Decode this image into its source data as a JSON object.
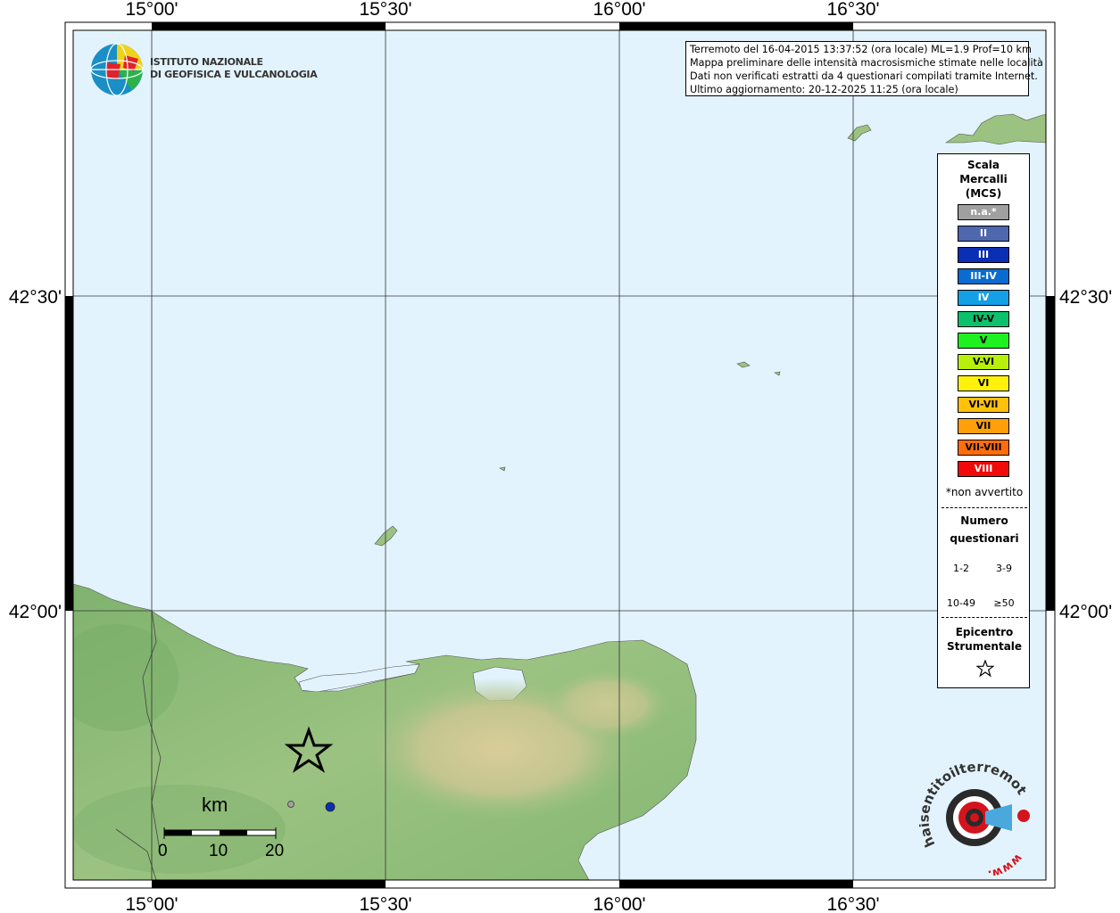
{
  "info": {
    "line1": "Terremoto del 16-04-2015 13:37:52 (ora locale) ML=1.9 Prof=10 km",
    "line2": "Mappa preliminare delle intensità macrosismiche stimate nelle località",
    "line3": "Dati non verificati estratti da 4 questionari compilati tramite Internet.",
    "line4": "Ultimo aggiornamento: 20-12-2025 11:25 (ora locale)"
  },
  "logo": {
    "line1": "ISTITUTO NAZIONALE",
    "line2": "DI GEOFISICA E VULCANOLOGIA"
  },
  "axes": {
    "lon_labels": [
      "15°00'",
      "15°30'",
      "16°00'",
      "16°30'"
    ],
    "lat_labels": [
      "42°30'",
      "42°00'"
    ]
  },
  "legend": {
    "title": [
      "Scala",
      "Mercalli",
      "(MCS)"
    ],
    "scale": [
      {
        "label": "n.a.*",
        "color": "#a0a0a0",
        "text": "#ffffff"
      },
      {
        "label": "II",
        "color": "#4f67ad",
        "text": "#ffffff"
      },
      {
        "label": "III",
        "color": "#0a2fb4",
        "text": "#ffffff"
      },
      {
        "label": "III-IV",
        "color": "#0a6ccf",
        "text": "#ffffff"
      },
      {
        "label": "IV",
        "color": "#14a0e6",
        "text": "#ffffff"
      },
      {
        "label": "IV-V",
        "color": "#0dc06b",
        "text": "#000000"
      },
      {
        "label": "V",
        "color": "#1ff01f",
        "text": "#000000"
      },
      {
        "label": "V-VI",
        "color": "#b8f00a",
        "text": "#000000"
      },
      {
        "label": "VI",
        "color": "#fff20a",
        "text": "#000000"
      },
      {
        "label": "VI-VII",
        "color": "#ffc10a",
        "text": "#000000"
      },
      {
        "label": "VII",
        "color": "#ffa00a",
        "text": "#000000"
      },
      {
        "label": "VII-VIII",
        "color": "#ff6e0a",
        "text": "#000000"
      },
      {
        "label": "VIII",
        "color": "#f00a0a",
        "text": "#ffffff"
      }
    ],
    "na_note": "*non avvertito",
    "count_title": [
      "Numero",
      "questionari"
    ],
    "counts": [
      "1-2",
      "3-9",
      "10-49",
      "≥50"
    ],
    "epicenter_title": [
      "Epicentro",
      "Strumentale"
    ]
  },
  "scalebar": {
    "unit": "km",
    "ticks": [
      "0",
      "10",
      "20"
    ]
  },
  "points": [
    {
      "intensity": "n.a.*",
      "color": "#a0a0a0"
    },
    {
      "intensity": "III",
      "color": "#0a2fb4"
    }
  ],
  "watermark": {
    "text": "haisentitoilterremoto.it",
    "prefix": "www."
  }
}
